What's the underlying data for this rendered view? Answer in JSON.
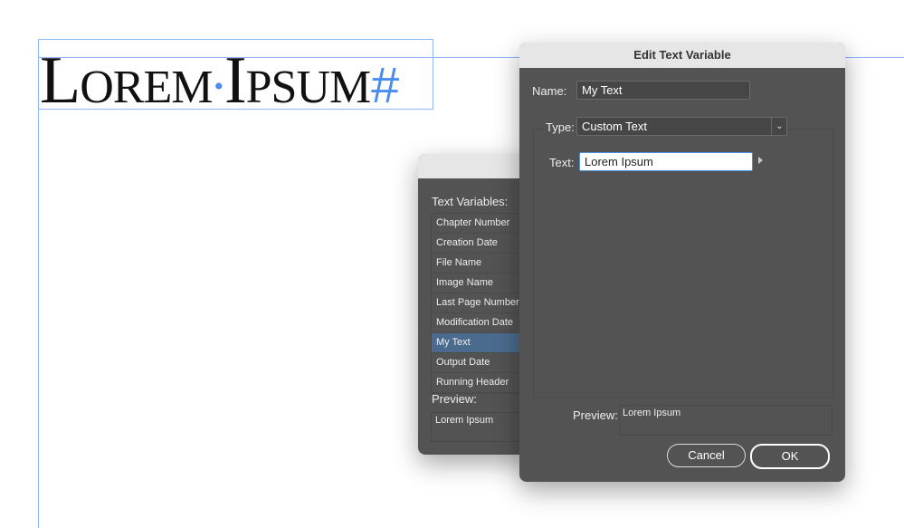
{
  "document": {
    "text": "Lorem Ipsum",
    "words": [
      "Lorem",
      "Ipsum"
    ],
    "space_marker": "•",
    "end_marker": "#"
  },
  "back_dialog": {
    "list_label": "Text Variables:",
    "items": [
      "Chapter Number",
      "Creation Date",
      "File Name",
      "Image Name",
      "Last Page Number",
      "Modification Date",
      "My Text",
      "Output Date",
      "Running Header"
    ],
    "selected": "My Text",
    "preview_label": "Preview:",
    "preview_value": "Lorem Ipsum"
  },
  "edit_dialog": {
    "title": "Edit Text Variable",
    "name_label": "Name:",
    "name_value": "My Text",
    "type_label": "Type:",
    "type_value": "Custom Text",
    "text_label": "Text:",
    "text_value": "Lorem Ipsum",
    "preview_label": "Preview:",
    "preview_value": "Lorem Ipsum",
    "cancel_label": "Cancel",
    "ok_label": "OK"
  },
  "colors": {
    "guide": "#8fb6ff",
    "dialog_bg": "#535353",
    "selection": "#4b6b8e",
    "focus": "#4a90e2"
  }
}
